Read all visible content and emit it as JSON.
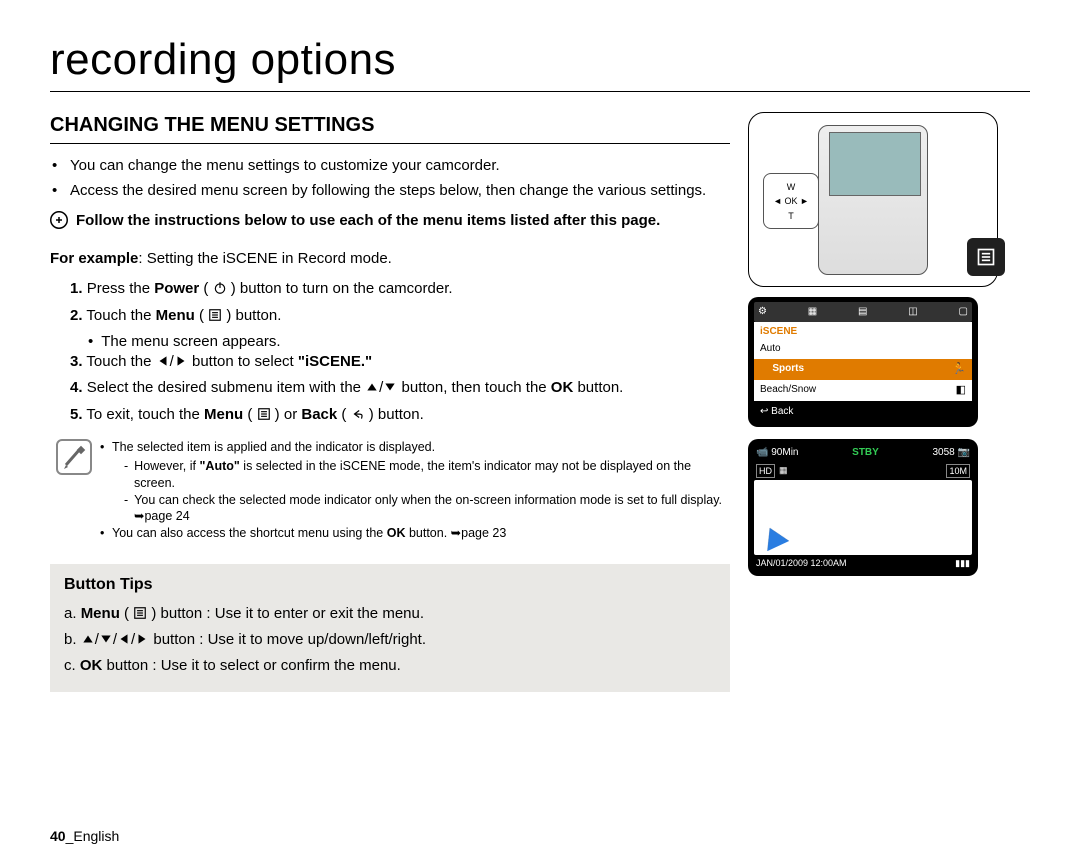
{
  "title": "recording options",
  "heading": "CHANGING THE MENU SETTINGS",
  "intro": {
    "b1": "You can change the menu settings to customize your camcorder.",
    "b2": "Access the desired menu screen by following the steps below, then change the various settings."
  },
  "arrow_note": "Follow the instructions below to use each of the menu items listed after this page.",
  "example": {
    "label": "For example",
    "text": ": Setting the iSCENE in Record mode."
  },
  "steps": {
    "s1a": "Press the ",
    "s1b": "Power",
    "s1c": " ( ",
    "s1d": " ) button to turn on the camcorder.",
    "s2a": "Touch the ",
    "s2b": "Menu",
    "s2c": " ( ",
    "s2d": " ) button.",
    "s2_sub": "The menu screen appears.",
    "s3a": "Touch the ",
    "s3b": " button to select ",
    "s3c": "\"iSCENE.\"",
    "s4a": "Select the desired submenu item with the ",
    "s4b": " button, then touch the ",
    "s4c": "OK",
    "s4d": " button.",
    "s5a": "To exit, touch the ",
    "s5b": "Menu",
    "s5c": " ( ",
    "s5d": " ) or ",
    "s5e": "Back",
    "s5f": " ( ",
    "s5g": " ) button."
  },
  "notes": {
    "n1": "The selected item is applied and the indicator is displayed.",
    "n1a_pre": "However, if ",
    "n1a_bold": "\"Auto\"",
    "n1a_post": " is selected in the iSCENE mode, the item's indicator may not be displayed on the screen.",
    "n1b": "You can check the selected mode indicator only when the on-screen information mode is set to full display. ➥page 24",
    "n2_pre": "You can also access the shortcut menu using the ",
    "n2_bold": "OK",
    "n2_post": " button. ➥page 23"
  },
  "tips": {
    "title": "Button Tips",
    "a_pre": "a.  ",
    "a_bold": "Menu",
    "a_mid": " ( ",
    "a_post": " ) button : Use it to enter or exit the menu.",
    "b_pre": "b.  ",
    "b_post": " button : Use it to move up/down/left/right.",
    "c_pre": "c.  ",
    "c_bold": "OK",
    "c_post": " button : Use it to select or confirm the menu."
  },
  "screen1": {
    "label": "iSCENE",
    "opt1": "Auto",
    "opt2": "Sports",
    "opt3": "Beach/Snow",
    "back": "Back"
  },
  "screen2": {
    "time": "90Min",
    "stby": "STBY",
    "count": "3058",
    "date": "JAN/01/2009 12:00AM"
  },
  "footer": {
    "page": "40",
    "sep": "_",
    "lang": "English"
  }
}
